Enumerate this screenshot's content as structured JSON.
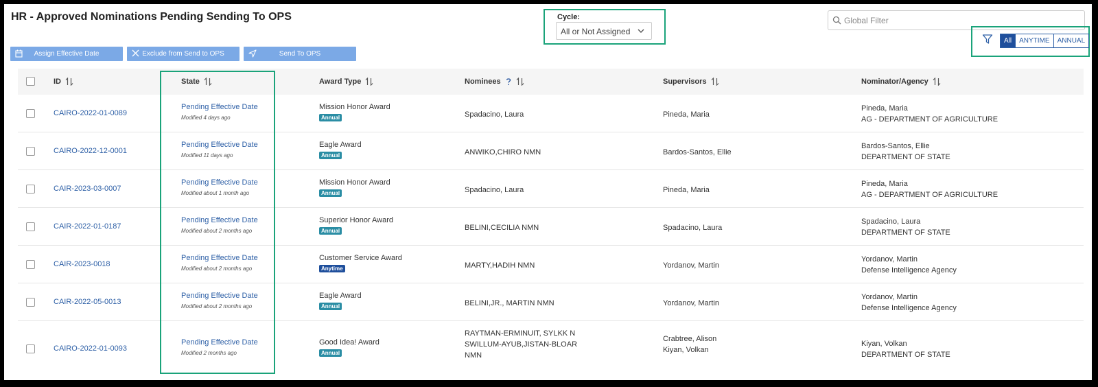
{
  "page": {
    "title": "HR - Approved Nominations Pending Sending To OPS"
  },
  "cycle": {
    "label": "Cycle:",
    "value": "All or Not Assigned"
  },
  "search": {
    "placeholder": "Global Filter"
  },
  "award_filter": {
    "options": [
      "All",
      "ANYTIME",
      "ANNUAL"
    ],
    "selected": "All"
  },
  "toolbar": {
    "assign_label": "Assign Effective Date",
    "exclude_label": "Exclude from Send to OPS",
    "send_label": "Send To OPS"
  },
  "columns": {
    "id": "ID",
    "state": "State",
    "award_type": "Award Type",
    "nominees": "Nominees",
    "supervisors": "Supervisors",
    "nominator": "Nominator/Agency"
  },
  "rows": [
    {
      "id": "CAIRO-2022-01-0089",
      "state": "Pending Effective Date",
      "modified": "Modified 4 days ago",
      "award": "Mission Honor Award",
      "badge": "Annual",
      "nominees": [
        "Spadacino, Laura"
      ],
      "supervisors": [
        "Pineda, Maria"
      ],
      "nominator": "Pineda, Maria",
      "agency": "AG - DEPARTMENT OF AGRICULTURE"
    },
    {
      "id": "CAIRO-2022-12-0001",
      "state": "Pending Effective Date",
      "modified": "Modified 11 days ago",
      "award": "Eagle Award",
      "badge": "Annual",
      "nominees": [
        "ANWIKO,CHIRO NMN"
      ],
      "supervisors": [
        "Bardos-Santos, Ellie"
      ],
      "nominator": "Bardos-Santos, Ellie",
      "agency": "DEPARTMENT OF STATE"
    },
    {
      "id": "CAIR-2023-03-0007",
      "state": "Pending Effective Date",
      "modified": "Modified about 1 month ago",
      "award": "Mission Honor Award",
      "badge": "Annual",
      "nominees": [
        "Spadacino, Laura"
      ],
      "supervisors": [
        "Pineda, Maria"
      ],
      "nominator": "Pineda, Maria",
      "agency": "AG - DEPARTMENT OF AGRICULTURE"
    },
    {
      "id": "CAIR-2022-01-0187",
      "state": "Pending Effective Date",
      "modified": "Modified about 2 months ago",
      "award": "Superior Honor Award",
      "badge": "Annual",
      "nominees": [
        "BELINI,CECILIA NMN"
      ],
      "supervisors": [
        "Spadacino, Laura"
      ],
      "nominator": "Spadacino, Laura",
      "agency": "DEPARTMENT OF STATE"
    },
    {
      "id": "CAIR-2023-0018",
      "state": "Pending Effective Date",
      "modified": "Modified about 2 months ago",
      "award": "Customer Service Award",
      "badge": "Anytime",
      "nominees": [
        "MARTY,HADIH NMN"
      ],
      "supervisors": [
        "Yordanov, Martin"
      ],
      "nominator": "Yordanov, Martin",
      "agency": "Defense Intelligence Agency"
    },
    {
      "id": "CAIR-2022-05-0013",
      "state": "Pending Effective Date",
      "modified": "Modified about 2 months ago",
      "award": "Eagle Award",
      "badge": "Annual",
      "nominees": [
        "BELINI,JR., MARTIN NMN"
      ],
      "supervisors": [
        "Yordanov, Martin"
      ],
      "nominator": "Yordanov, Martin",
      "agency": "Defense Intelligence Agency"
    },
    {
      "id": "CAIRO-2022-01-0093",
      "state": "Pending Effective Date",
      "modified": "Modified 2 months ago",
      "award": "Good Idea! Award",
      "badge": "Annual",
      "nominees": [
        "RAYTMAN-ERMINUIT, SYLKK N",
        "SWILLUM-AYUB,JISTAN-BLOAR",
        "NMN"
      ],
      "supervisors": [
        "Crabtree, Alison",
        "Kiyan, Volkan"
      ],
      "nominator": "Kiyan, Volkan",
      "agency": "DEPARTMENT OF STATE"
    }
  ]
}
